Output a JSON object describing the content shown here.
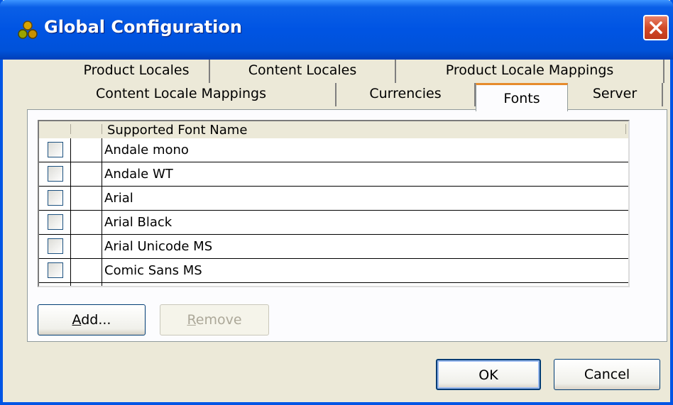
{
  "window": {
    "title": "Global Configuration",
    "close_icon": "close-icon"
  },
  "tabs_row1": [
    "Product Locales",
    "Content Locales",
    "Product Locale Mappings"
  ],
  "tabs_row2": [
    "Content Locale Mappings",
    "Currencies",
    "Fonts",
    "Server"
  ],
  "selected_tab": "Fonts",
  "table": {
    "column_header": "Supported Font Name",
    "rows": [
      {
        "name": "Andale mono",
        "checked": false
      },
      {
        "name": "Andale WT",
        "checked": false
      },
      {
        "name": "Arial",
        "checked": false
      },
      {
        "name": "Arial Black",
        "checked": false
      },
      {
        "name": "Arial Unicode MS",
        "checked": false
      },
      {
        "name": "Comic Sans MS",
        "checked": false
      }
    ]
  },
  "buttons": {
    "add": {
      "mnemonic": "A",
      "rest": "dd..."
    },
    "remove": {
      "mnemonic": "R",
      "rest": "emove"
    },
    "ok": "OK",
    "cancel": "Cancel"
  },
  "colors": {
    "titlebar": "#0054e3",
    "close_button": "#d24a27",
    "tab_highlight": "#e68b2c",
    "dialog_bg": "#ece9d8"
  }
}
